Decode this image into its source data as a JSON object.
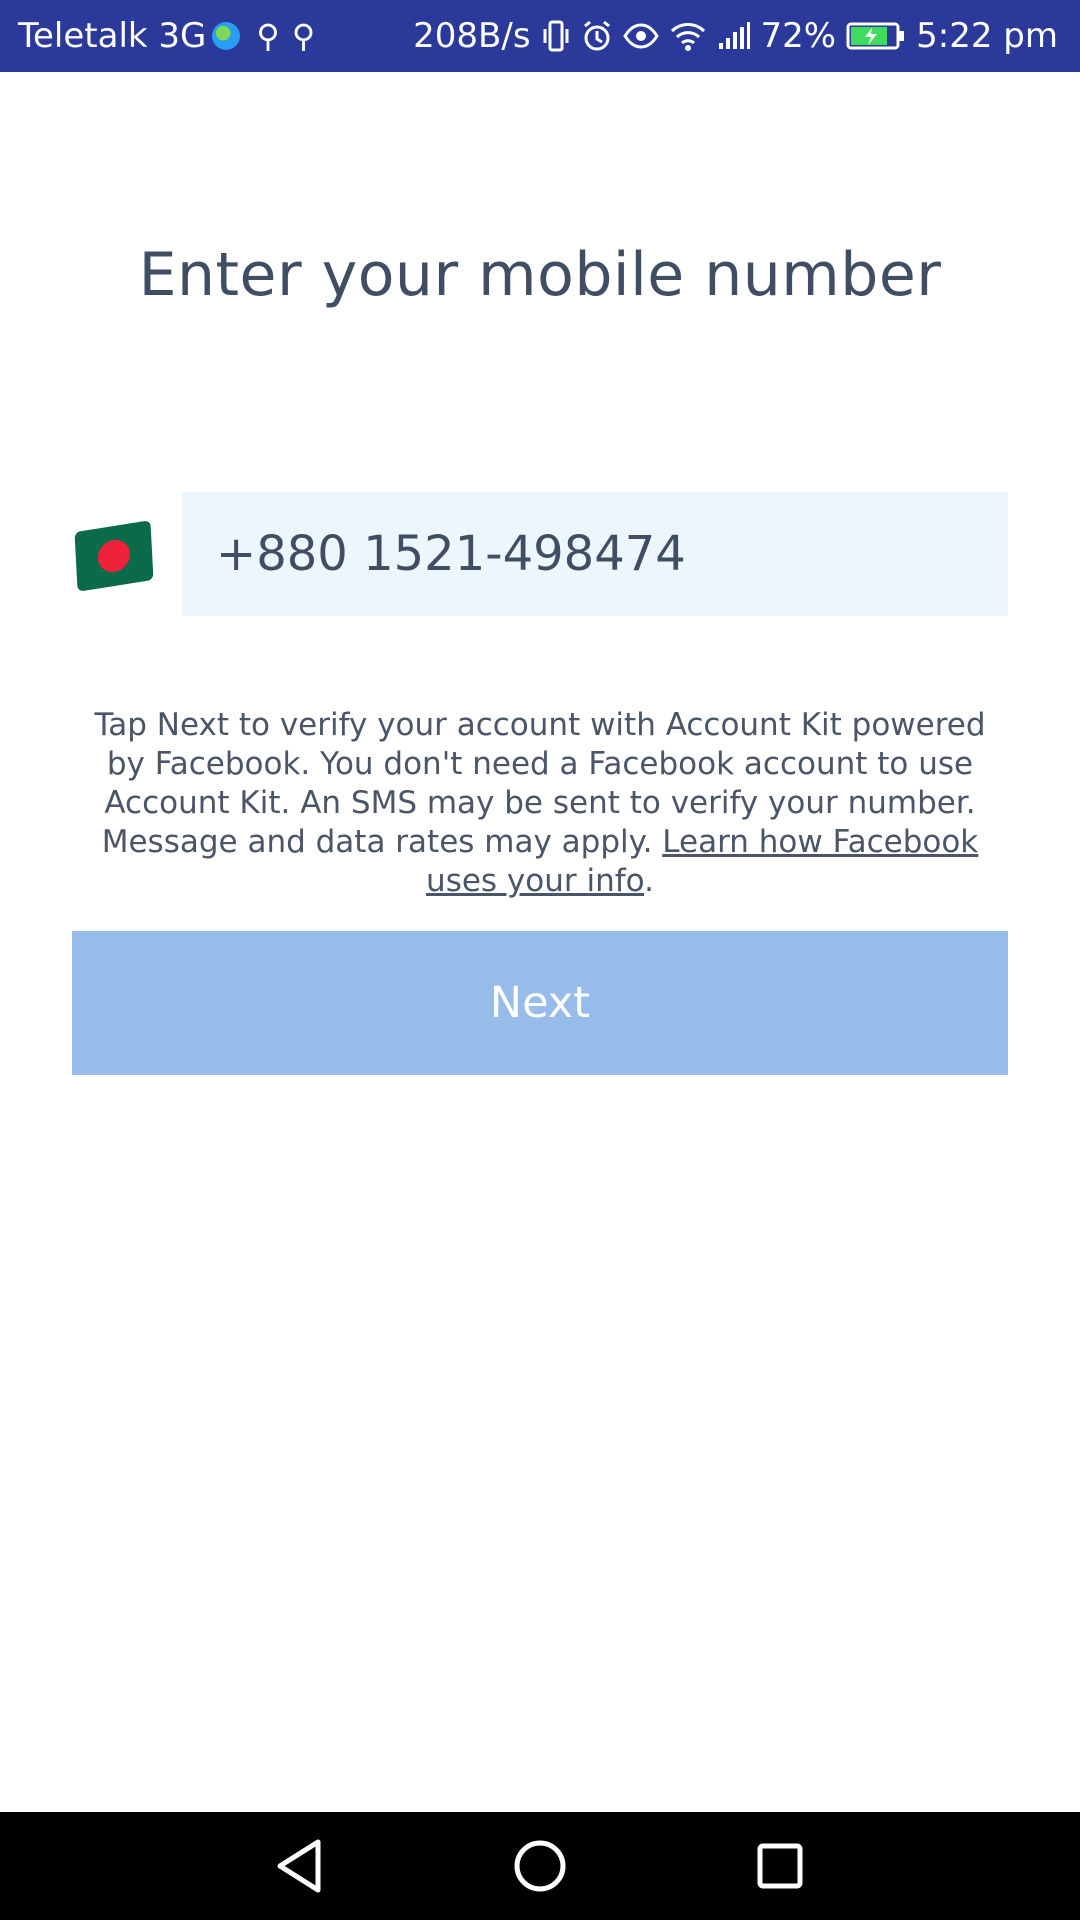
{
  "status_bar": {
    "carrier": "Teletalk 3G",
    "network_speed": "208B/s",
    "battery_percent": "72%",
    "time": "5:22 pm",
    "icons": [
      "globe-icon",
      "usb-icon",
      "usb-icon",
      "vibrate-icon",
      "alarm-icon",
      "eye-icon",
      "wifi-icon",
      "signal-icon",
      "battery-charging-icon"
    ]
  },
  "main": {
    "title": "Enter your mobile number",
    "country_flag": "bangladesh-flag-icon",
    "phone_value": "+880 1521-498474",
    "disclaimer_text": "Tap Next to verify your account with Account Kit powered by Facebook. You don't need a Facebook account to use Account Kit. An SMS may be sent to verify your number. Message and data rates may apply. ",
    "disclaimer_link": "Learn how Facebook uses your info",
    "disclaimer_end": ".",
    "next_label": "Next"
  },
  "colors": {
    "status_bar_bg": "#2b3a9a",
    "text": "#3f4e63",
    "field_bg": "#edf5fd",
    "button_bg": "#98bcea",
    "nav_bar_bg": "#000000"
  },
  "nav_bar": {
    "icons": [
      "back-icon",
      "home-icon",
      "recent-apps-icon"
    ]
  }
}
